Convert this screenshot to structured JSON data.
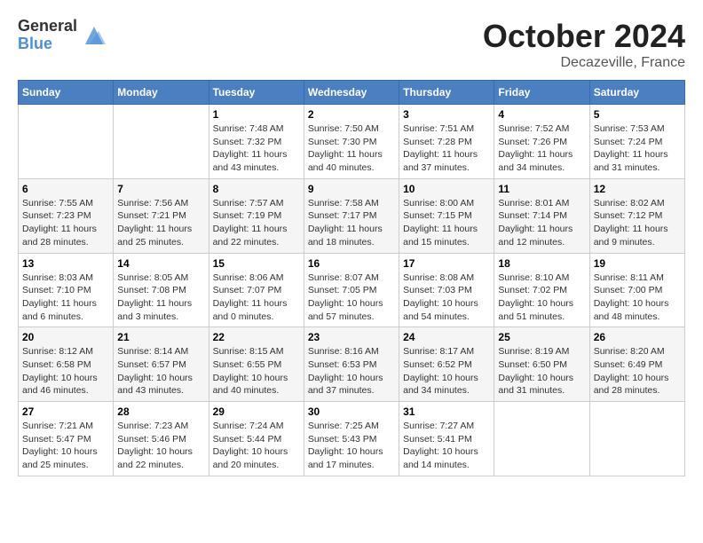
{
  "header": {
    "logo_general": "General",
    "logo_blue": "Blue",
    "month_title": "October 2024",
    "location": "Decazeville, France"
  },
  "days_of_week": [
    "Sunday",
    "Monday",
    "Tuesday",
    "Wednesday",
    "Thursday",
    "Friday",
    "Saturday"
  ],
  "weeks": [
    [
      {
        "day": "",
        "info": ""
      },
      {
        "day": "",
        "info": ""
      },
      {
        "day": "1",
        "info": "Sunrise: 7:48 AM\nSunset: 7:32 PM\nDaylight: 11 hours and 43 minutes."
      },
      {
        "day": "2",
        "info": "Sunrise: 7:50 AM\nSunset: 7:30 PM\nDaylight: 11 hours and 40 minutes."
      },
      {
        "day": "3",
        "info": "Sunrise: 7:51 AM\nSunset: 7:28 PM\nDaylight: 11 hours and 37 minutes."
      },
      {
        "day": "4",
        "info": "Sunrise: 7:52 AM\nSunset: 7:26 PM\nDaylight: 11 hours and 34 minutes."
      },
      {
        "day": "5",
        "info": "Sunrise: 7:53 AM\nSunset: 7:24 PM\nDaylight: 11 hours and 31 minutes."
      }
    ],
    [
      {
        "day": "6",
        "info": "Sunrise: 7:55 AM\nSunset: 7:23 PM\nDaylight: 11 hours and 28 minutes."
      },
      {
        "day": "7",
        "info": "Sunrise: 7:56 AM\nSunset: 7:21 PM\nDaylight: 11 hours and 25 minutes."
      },
      {
        "day": "8",
        "info": "Sunrise: 7:57 AM\nSunset: 7:19 PM\nDaylight: 11 hours and 22 minutes."
      },
      {
        "day": "9",
        "info": "Sunrise: 7:58 AM\nSunset: 7:17 PM\nDaylight: 11 hours and 18 minutes."
      },
      {
        "day": "10",
        "info": "Sunrise: 8:00 AM\nSunset: 7:15 PM\nDaylight: 11 hours and 15 minutes."
      },
      {
        "day": "11",
        "info": "Sunrise: 8:01 AM\nSunset: 7:14 PM\nDaylight: 11 hours and 12 minutes."
      },
      {
        "day": "12",
        "info": "Sunrise: 8:02 AM\nSunset: 7:12 PM\nDaylight: 11 hours and 9 minutes."
      }
    ],
    [
      {
        "day": "13",
        "info": "Sunrise: 8:03 AM\nSunset: 7:10 PM\nDaylight: 11 hours and 6 minutes."
      },
      {
        "day": "14",
        "info": "Sunrise: 8:05 AM\nSunset: 7:08 PM\nDaylight: 11 hours and 3 minutes."
      },
      {
        "day": "15",
        "info": "Sunrise: 8:06 AM\nSunset: 7:07 PM\nDaylight: 11 hours and 0 minutes."
      },
      {
        "day": "16",
        "info": "Sunrise: 8:07 AM\nSunset: 7:05 PM\nDaylight: 10 hours and 57 minutes."
      },
      {
        "day": "17",
        "info": "Sunrise: 8:08 AM\nSunset: 7:03 PM\nDaylight: 10 hours and 54 minutes."
      },
      {
        "day": "18",
        "info": "Sunrise: 8:10 AM\nSunset: 7:02 PM\nDaylight: 10 hours and 51 minutes."
      },
      {
        "day": "19",
        "info": "Sunrise: 8:11 AM\nSunset: 7:00 PM\nDaylight: 10 hours and 48 minutes."
      }
    ],
    [
      {
        "day": "20",
        "info": "Sunrise: 8:12 AM\nSunset: 6:58 PM\nDaylight: 10 hours and 46 minutes."
      },
      {
        "day": "21",
        "info": "Sunrise: 8:14 AM\nSunset: 6:57 PM\nDaylight: 10 hours and 43 minutes."
      },
      {
        "day": "22",
        "info": "Sunrise: 8:15 AM\nSunset: 6:55 PM\nDaylight: 10 hours and 40 minutes."
      },
      {
        "day": "23",
        "info": "Sunrise: 8:16 AM\nSunset: 6:53 PM\nDaylight: 10 hours and 37 minutes."
      },
      {
        "day": "24",
        "info": "Sunrise: 8:17 AM\nSunset: 6:52 PM\nDaylight: 10 hours and 34 minutes."
      },
      {
        "day": "25",
        "info": "Sunrise: 8:19 AM\nSunset: 6:50 PM\nDaylight: 10 hours and 31 minutes."
      },
      {
        "day": "26",
        "info": "Sunrise: 8:20 AM\nSunset: 6:49 PM\nDaylight: 10 hours and 28 minutes."
      }
    ],
    [
      {
        "day": "27",
        "info": "Sunrise: 7:21 AM\nSunset: 5:47 PM\nDaylight: 10 hours and 25 minutes."
      },
      {
        "day": "28",
        "info": "Sunrise: 7:23 AM\nSunset: 5:46 PM\nDaylight: 10 hours and 22 minutes."
      },
      {
        "day": "29",
        "info": "Sunrise: 7:24 AM\nSunset: 5:44 PM\nDaylight: 10 hours and 20 minutes."
      },
      {
        "day": "30",
        "info": "Sunrise: 7:25 AM\nSunset: 5:43 PM\nDaylight: 10 hours and 17 minutes."
      },
      {
        "day": "31",
        "info": "Sunrise: 7:27 AM\nSunset: 5:41 PM\nDaylight: 10 hours and 14 minutes."
      },
      {
        "day": "",
        "info": ""
      },
      {
        "day": "",
        "info": ""
      }
    ]
  ]
}
